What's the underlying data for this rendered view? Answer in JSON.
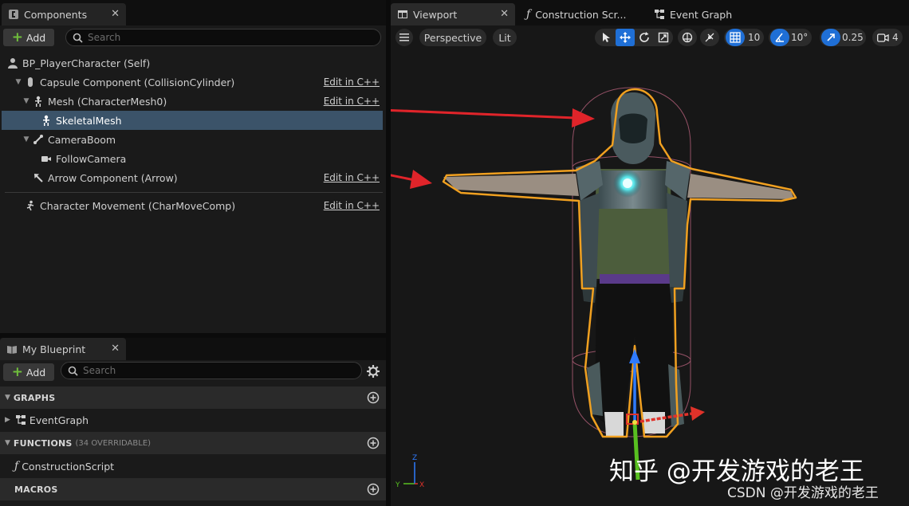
{
  "components_panel": {
    "tab_label": "Components",
    "add_label": "Add",
    "search_placeholder": "Search",
    "edit_cpp_label": "Edit in C++",
    "tree": [
      {
        "label": "BP_PlayerCharacter (Self)",
        "icon": "person-icon",
        "edit": false
      },
      {
        "label": "Capsule Component (CollisionCylinder)",
        "icon": "capsule-icon",
        "edit": true
      },
      {
        "label": "Mesh (CharacterMesh0)",
        "icon": "skeleton-icon",
        "edit": true
      },
      {
        "label": "SkeletalMesh",
        "icon": "skeleton-icon",
        "edit": false,
        "selected": true
      },
      {
        "label": "CameraBoom",
        "icon": "spring-arm-icon",
        "edit": false
      },
      {
        "label": "FollowCamera",
        "icon": "camera-icon",
        "edit": false
      },
      {
        "label": "Arrow Component (Arrow)",
        "icon": "arrow-icon",
        "edit": true
      },
      {
        "label": "Character Movement (CharMoveComp)",
        "icon": "movement-icon",
        "edit": true
      }
    ]
  },
  "blueprint_panel": {
    "tab_label": "My Blueprint",
    "add_label": "Add",
    "search_placeholder": "Search",
    "sections": [
      {
        "title": "GRAPHS",
        "subtitle": "",
        "items": [
          "EventGraph"
        ]
      },
      {
        "title": "FUNCTIONS",
        "subtitle": "(34 OVERRIDABLE)",
        "items": [
          "ConstructionScript"
        ]
      },
      {
        "title": "MACROS",
        "subtitle": "",
        "items": []
      }
    ]
  },
  "viewport": {
    "tabs": [
      "Viewport",
      "Construction Scr...",
      "Event Graph"
    ],
    "perspective_label": "Perspective",
    "lit_label": "Lit",
    "grid_snap": "10",
    "rotation_snap": "10°",
    "scale_snap": "0.25",
    "camera_speed": "4",
    "axis_labels": {
      "y": "Y",
      "z": "Z",
      "x": "X"
    }
  },
  "watermark": {
    "main": "知乎 @开发游戏的老王",
    "sub": "CSDN @开发游戏的老王"
  },
  "colors": {
    "accent_blue": "#1f6fd6",
    "selection": "#3b5369",
    "add_green": "#6fbe3c",
    "highlight_orange": "#f0a020",
    "annotation_red": "#e0242a"
  }
}
